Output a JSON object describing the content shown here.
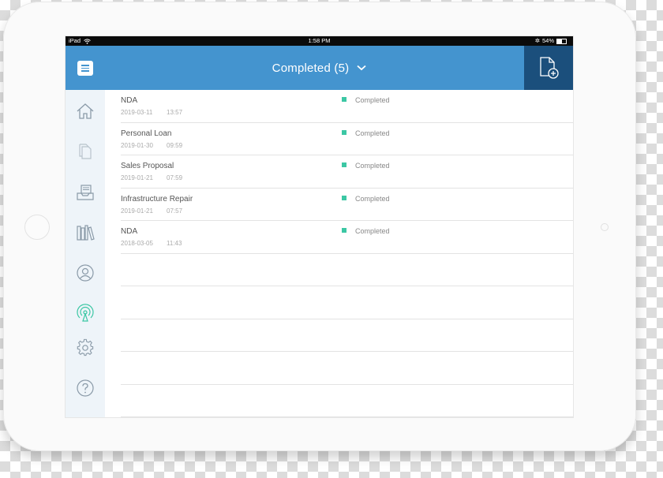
{
  "status_bar": {
    "device": "iPad",
    "time": "1:58 PM",
    "battery": "54%"
  },
  "header": {
    "title": "Completed (5)",
    "title_chevron": "chevron-down-icon"
  },
  "colors": {
    "header_bg": "#4494cf",
    "add_doc_bg": "#1b4f7c",
    "status_completed": "#3cc7a4",
    "sidebar_bg": "#eef4f9",
    "active_icon": "#3cc7a4"
  },
  "sidebar": {
    "items": [
      {
        "icon": "home-icon"
      },
      {
        "icon": "documents-icon"
      },
      {
        "icon": "inbox-icon"
      },
      {
        "icon": "library-icon"
      },
      {
        "icon": "user-icon"
      },
      {
        "icon": "broadcast-icon",
        "active": true
      },
      {
        "icon": "gear-icon"
      },
      {
        "icon": "help-icon"
      }
    ]
  },
  "documents": [
    {
      "name": "NDA",
      "date": "2019-03-11",
      "time": "13:57",
      "status": "Completed"
    },
    {
      "name": "Personal Loan",
      "date": "2019-01-30",
      "time": "09:59",
      "status": "Completed"
    },
    {
      "name": "Sales Proposal",
      "date": "2019-01-21",
      "time": "07:59",
      "status": "Completed"
    },
    {
      "name": "Infrastructure Repair",
      "date": "2019-01-21",
      "time": "07:57",
      "status": "Completed"
    },
    {
      "name": "NDA",
      "date": "2018-03-05",
      "time": "11:43",
      "status": "Completed"
    }
  ]
}
